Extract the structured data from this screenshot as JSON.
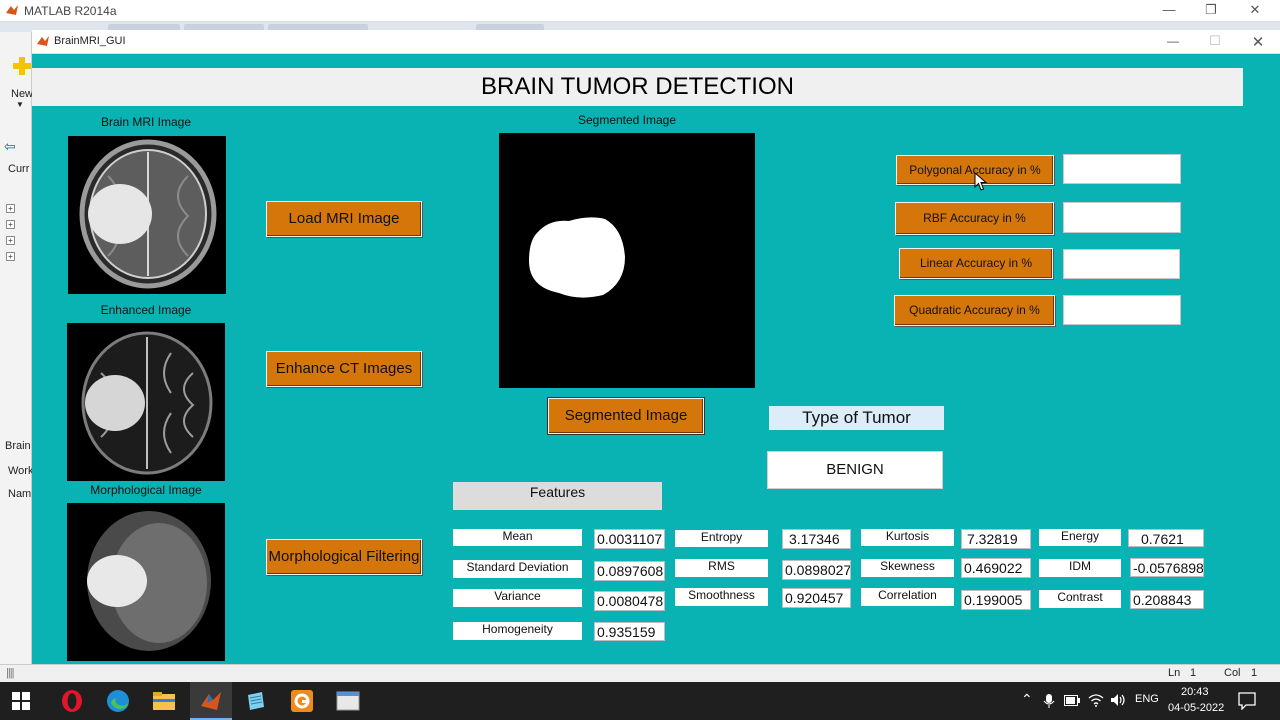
{
  "matlab": {
    "title": "MATLAB R2014a",
    "left_labels": {
      "new": "New",
      "current": "Curr",
      "brain": "Brain",
      "workspace": "Work",
      "name": "Nam"
    },
    "status": {
      "ln_label": "Ln",
      "ln_value": "1",
      "col_label": "Col",
      "col_value": "1"
    }
  },
  "window": {
    "title": "BrainMRI_GUI",
    "minimize": "—",
    "maximize": "☐",
    "close": "✕"
  },
  "banner": {
    "title": "BRAIN TUMOR DETECTION"
  },
  "images": {
    "brain_mri": "Brain MRI Image",
    "enhanced": "Enhanced Image",
    "morphological": "Morphological Image",
    "segmented": "Segmented Image"
  },
  "buttons": {
    "load_mri": "Load MRI Image",
    "enhance_ct": "Enhance CT Images",
    "morph_filter": "Morphological Filtering",
    "segmented": "Segmented Image",
    "polygonal": "Polygonal Accuracy in %",
    "rbf": "RBF Accuracy in %",
    "linear": "Linear Accuracy in %",
    "quadratic": "Quadratic Accuracy in %"
  },
  "tumor": {
    "label": "Type of Tumor",
    "value": "BENIGN"
  },
  "features": {
    "header": "Features",
    "items": [
      {
        "label": "Mean",
        "value": "0.0031107"
      },
      {
        "label": "Entropy",
        "value": "3.17346"
      },
      {
        "label": "Kurtosis",
        "value": "7.32819"
      },
      {
        "label": "Energy",
        "value": "0.7621"
      },
      {
        "label": "Standard Deviation",
        "value": "0.0897608"
      },
      {
        "label": "RMS",
        "value": "0.0898027"
      },
      {
        "label": "Skewness",
        "value": "0.469022"
      },
      {
        "label": "IDM",
        "value": "-0.0576898"
      },
      {
        "label": "Variance",
        "value": "0.0080478"
      },
      {
        "label": "Smoothness",
        "value": "0.920457"
      },
      {
        "label": "Correlation",
        "value": "0.199005"
      },
      {
        "label": "Contrast",
        "value": "0.208843"
      },
      {
        "label": "Homogeneity",
        "value": "0.935159"
      }
    ]
  },
  "taskbar": {
    "lang": "ENG",
    "time": "20:43",
    "date": "04-05-2022"
  },
  "colors": {
    "gui_bg": "#0ab3b3",
    "button_orange": "#d4760a",
    "tumor_label_bg": "#dcecf8"
  }
}
